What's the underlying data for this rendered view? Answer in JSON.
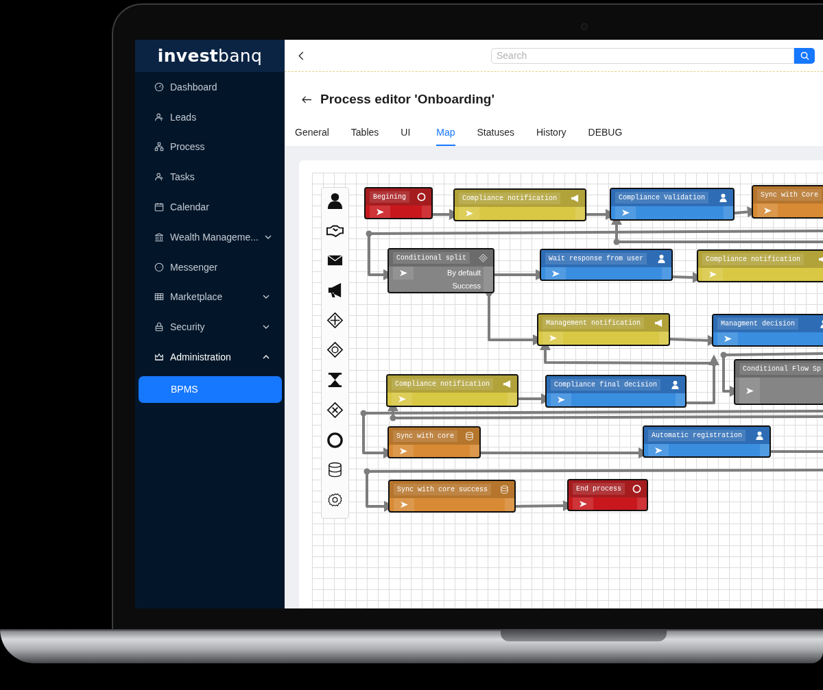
{
  "sidebar": {
    "logo": "**invest**banq",
    "items": [
      {
        "label": "Dashboard",
        "kind": "link",
        "selected": false
      },
      {
        "label": "Leads",
        "kind": "link",
        "selected": false
      },
      {
        "label": "Process",
        "kind": "link",
        "selected": false
      },
      {
        "label": "Tasks",
        "kind": "link",
        "selected": false
      },
      {
        "label": "Calendar",
        "kind": "link",
        "selected": false
      },
      {
        "label": "Wealth Manageme...",
        "kind": "group",
        "expanded": false,
        "selected": false
      },
      {
        "label": "Messenger",
        "kind": "link",
        "selected": false
      },
      {
        "label": "Marketplace",
        "kind": "group",
        "expanded": false,
        "selected": false
      },
      {
        "label": "Security",
        "kind": "group",
        "expanded": false,
        "selected": false
      },
      {
        "label": "Administration",
        "kind": "group",
        "expanded": true,
        "selected": false,
        "children": [
          {
            "label": "BPMS",
            "selected": true
          }
        ]
      }
    ]
  },
  "topbar": {
    "search": {
      "placeholder": "Search"
    }
  },
  "page": {
    "title": "Process editor 'Onboarding'",
    "tabs": [
      {
        "label": "General",
        "selected": false
      },
      {
        "label": "Tables",
        "selected": false
      },
      {
        "label": "UI",
        "selected": false
      },
      {
        "label": "Map",
        "selected": true
      },
      {
        "label": "Statuses",
        "selected": false
      },
      {
        "label": "History",
        "selected": false
      },
      {
        "label": "DEBUG",
        "selected": false
      }
    ]
  },
  "map": {
    "nodes": [
      {
        "title": "Begining",
        "kind": "event"
      },
      {
        "title": "Compliance notification",
        "kind": "notification"
      },
      {
        "title": "Compliance Validation",
        "kind": "user"
      },
      {
        "title": "Sync with Core",
        "kind": "service"
      },
      {
        "title": "Conditional split",
        "kind": "gateway",
        "outputs": [
          "By default",
          "Success"
        ]
      },
      {
        "title": "Wait response from user",
        "kind": "user"
      },
      {
        "title": "Compliance notification",
        "kind": "notification"
      },
      {
        "title": "Management notification",
        "kind": "notification"
      },
      {
        "title": "Managment decision",
        "kind": "user"
      },
      {
        "title": "Conditional Flow Sp",
        "kind": "gateway"
      },
      {
        "title": "Compliance notification",
        "kind": "notification"
      },
      {
        "title": "Compliance final decision",
        "kind": "user"
      },
      {
        "title": "Sync with core",
        "kind": "service"
      },
      {
        "title": "Automatic registration",
        "kind": "user"
      },
      {
        "title": "Sync with core success",
        "kind": "service"
      },
      {
        "title": "End process",
        "kind": "event"
      }
    ]
  }
}
